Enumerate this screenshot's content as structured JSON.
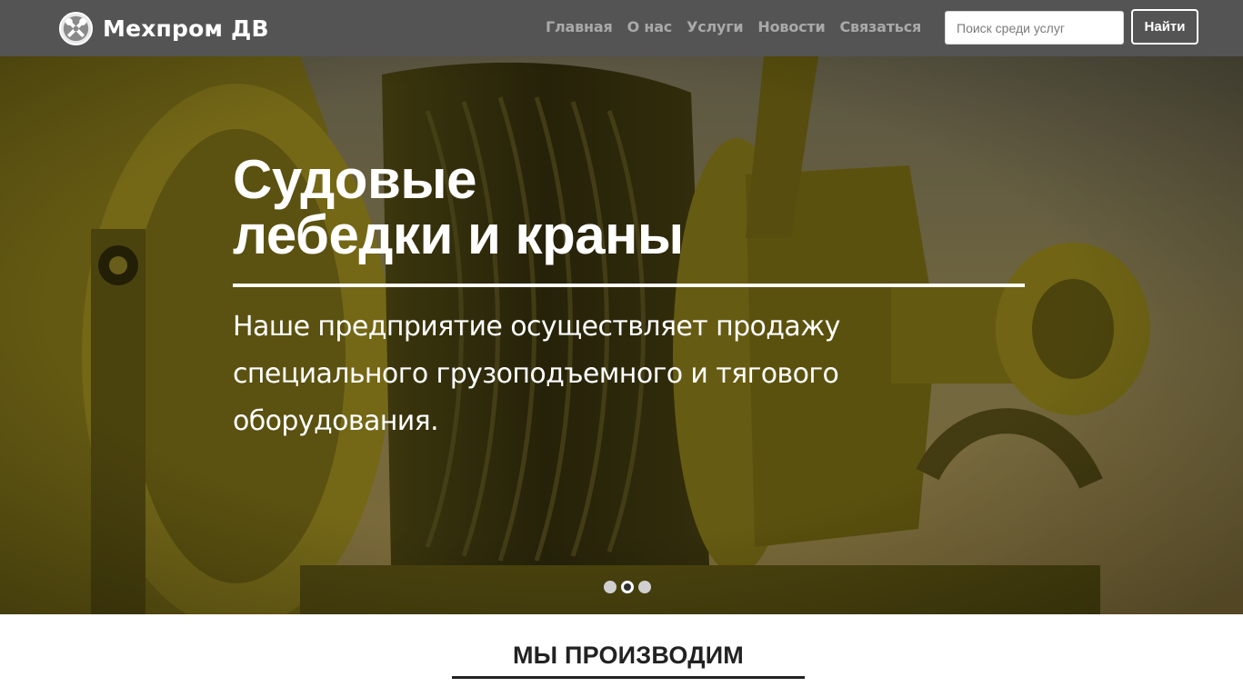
{
  "brand": {
    "name": "Мехпром ДВ",
    "logo_icon": "gear-wrench-icon"
  },
  "nav": {
    "items": [
      {
        "label": "Главная"
      },
      {
        "label": "О нас"
      },
      {
        "label": "Услуги"
      },
      {
        "label": "Новости"
      },
      {
        "label": "Связаться"
      }
    ]
  },
  "search": {
    "placeholder": "Поиск среди услуг",
    "value": "",
    "button_label": "Найти"
  },
  "hero": {
    "title_line1": "Судовые",
    "title_line2": "лебедки и краны",
    "text": "Наше предприятие осуществляет продажу специального грузоподъемного и тягового оборудования.",
    "slides_total": 3,
    "active_slide": 2
  },
  "section": {
    "title": "МЫ ПРОИЗВОДИМ"
  },
  "colors": {
    "navbar_bg": "#545454",
    "nav_link": "#a9a9a9",
    "hero_tint": "#8a7a1c",
    "text_white": "#ffffff",
    "section_text": "#222222"
  }
}
